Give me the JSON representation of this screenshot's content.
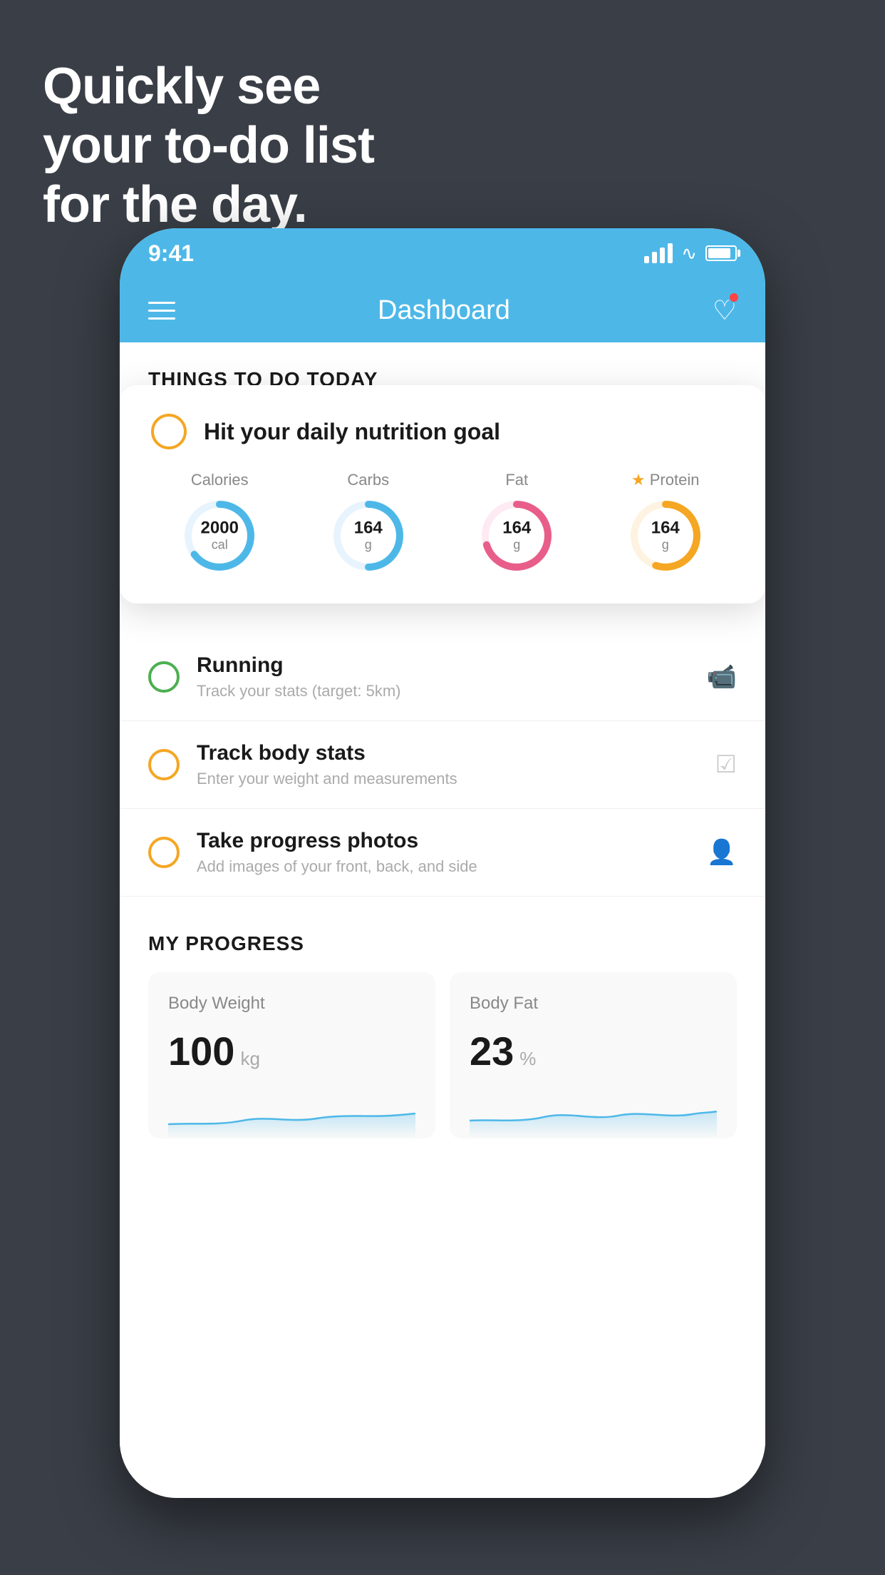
{
  "hero": {
    "line1": "Quickly see",
    "line2": "your to-do list",
    "line3": "for the day."
  },
  "statusBar": {
    "time": "9:41"
  },
  "navBar": {
    "title": "Dashboard"
  },
  "thingsToday": {
    "sectionLabel": "THINGS TO DO TODAY"
  },
  "nutritionCard": {
    "checkType": "circle",
    "title": "Hit your daily nutrition goal",
    "items": [
      {
        "label": "Calories",
        "value": "2000",
        "unit": "cal",
        "color": "#4db8e8",
        "percent": 65,
        "starred": false
      },
      {
        "label": "Carbs",
        "value": "164",
        "unit": "g",
        "color": "#4db8e8",
        "percent": 50,
        "starred": false
      },
      {
        "label": "Fat",
        "value": "164",
        "unit": "g",
        "color": "#e85d8a",
        "percent": 70,
        "starred": false
      },
      {
        "label": "Protein",
        "value": "164",
        "unit": "g",
        "color": "#f5a623",
        "percent": 55,
        "starred": true
      }
    ]
  },
  "todoItems": [
    {
      "title": "Running",
      "subtitle": "Track your stats (target: 5km)",
      "circleColor": "green",
      "icon": "shoe"
    },
    {
      "title": "Track body stats",
      "subtitle": "Enter your weight and measurements",
      "circleColor": "yellow",
      "icon": "scale"
    },
    {
      "title": "Take progress photos",
      "subtitle": "Add images of your front, back, and side",
      "circleColor": "yellow",
      "icon": "person"
    }
  ],
  "progressSection": {
    "title": "MY PROGRESS",
    "cards": [
      {
        "title": "Body Weight",
        "value": "100",
        "unit": "kg"
      },
      {
        "title": "Body Fat",
        "value": "23",
        "unit": "%"
      }
    ]
  }
}
